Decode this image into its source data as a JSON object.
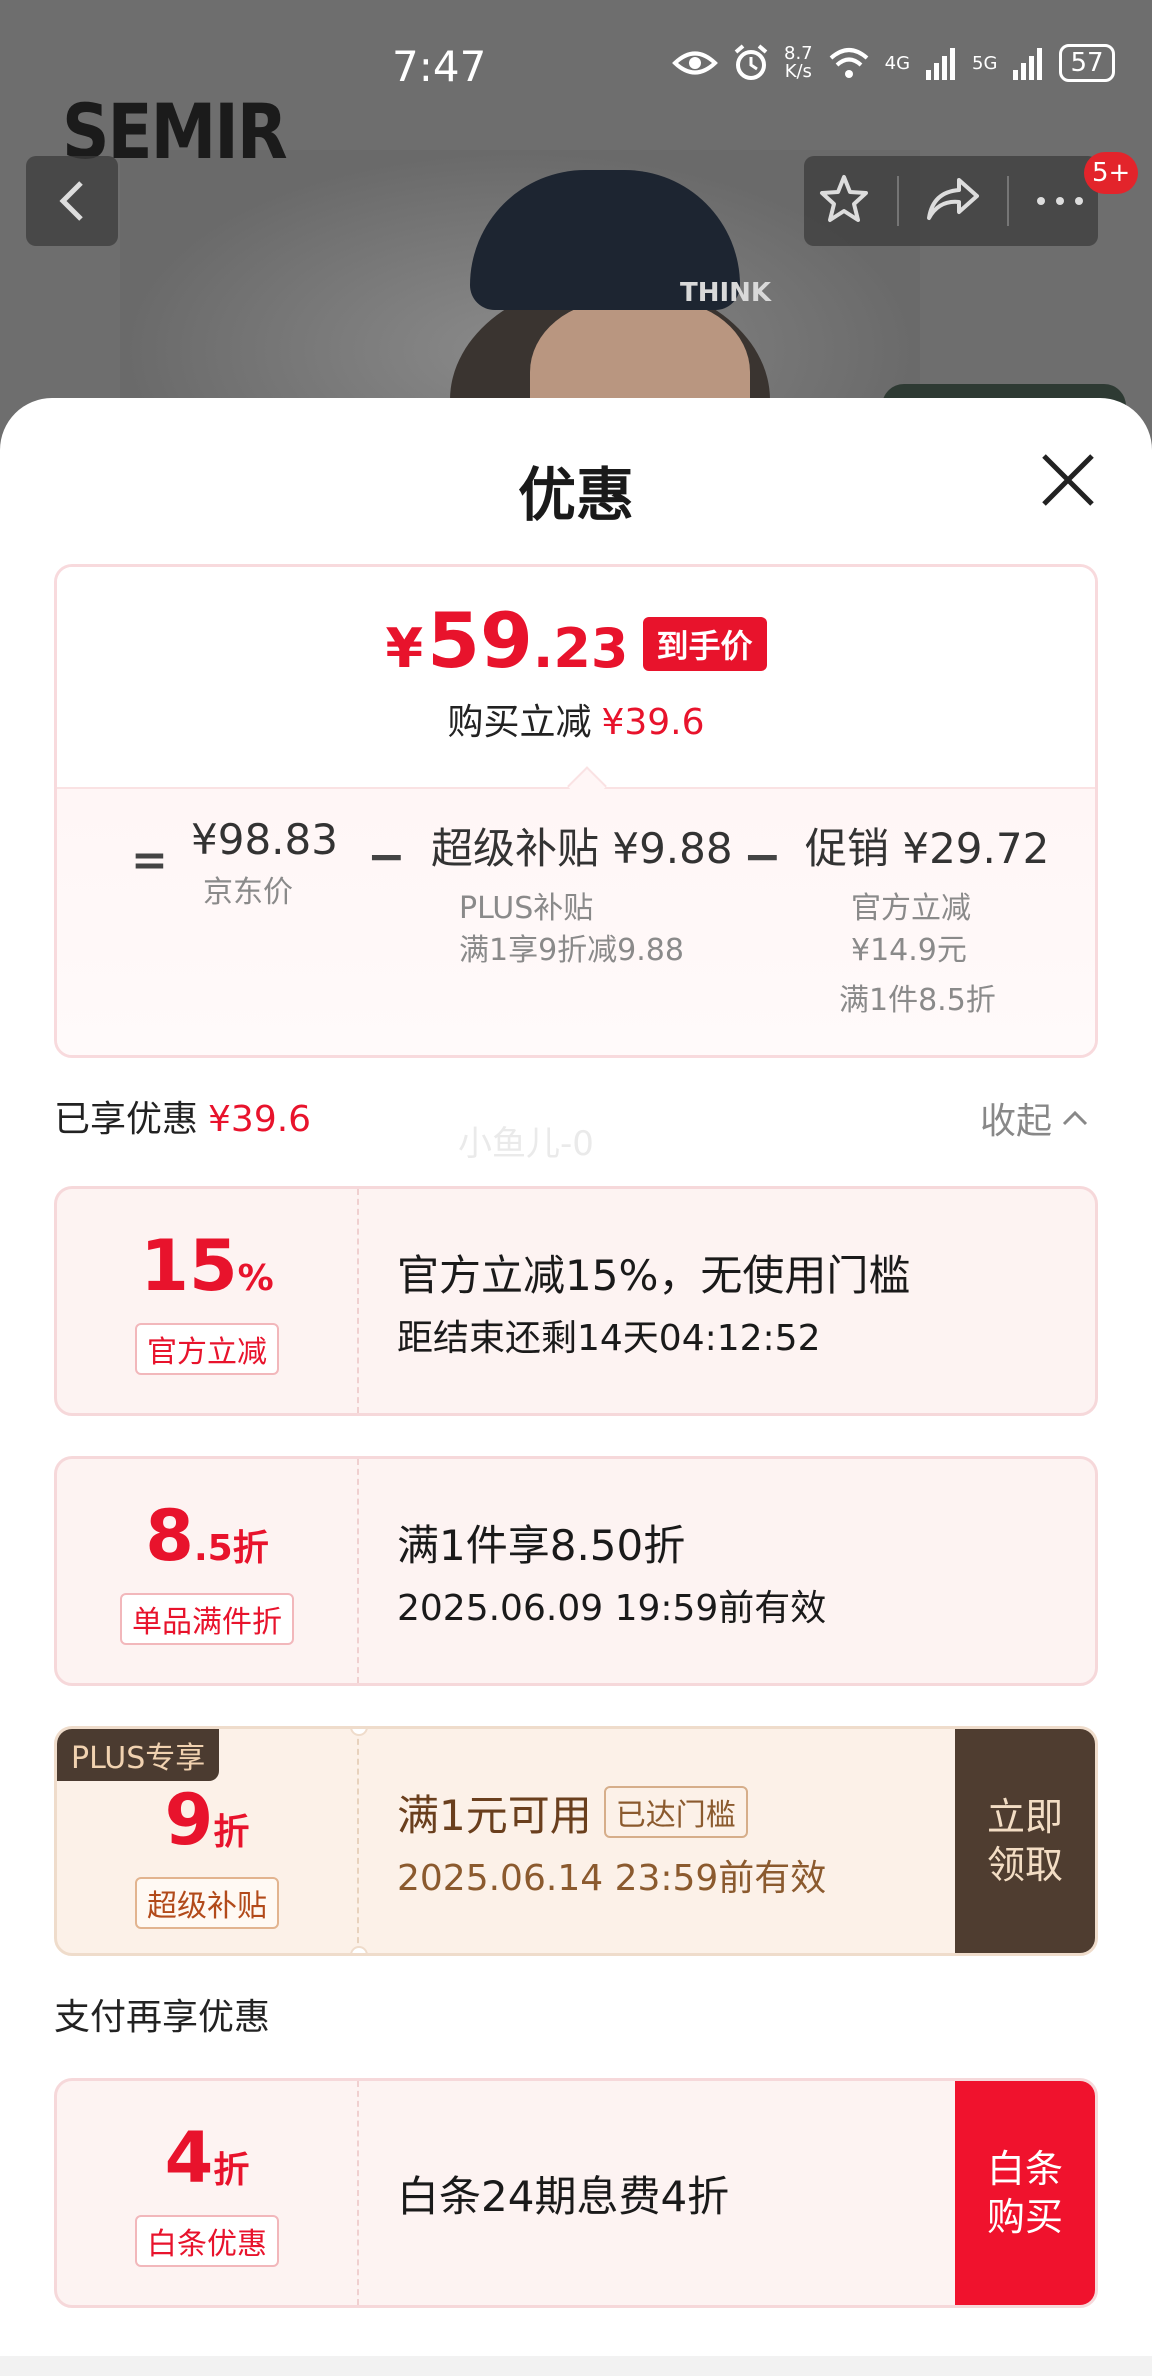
{
  "status_bar": {
    "time": "7:47",
    "net_speed_value": "8.7",
    "net_speed_unit": "K/s",
    "signal_1": "4G",
    "signal_2": "5G",
    "battery": "57"
  },
  "background": {
    "brand": "SEMIR",
    "cap_logo": "THINK",
    "notification_count": "5+"
  },
  "sheet": {
    "title": "优惠",
    "final_price": {
      "currency": "¥",
      "integer": "59",
      "decimal": ".23",
      "tag": "到手价"
    },
    "saving_label": "购买立减",
    "saving_amount": "¥39.6",
    "calc": {
      "equals": "=",
      "minus": "−",
      "jd_price": "¥98.83",
      "jd_label": "京东价",
      "subsidy_title": "超级补贴 ¥9.88",
      "subsidy_sub1": "PLUS补贴",
      "subsidy_sub2": "满1享9折减9.88",
      "promo_title": "促销 ¥29.72",
      "promo_sub1": "官方立减",
      "promo_sub2": "¥14.9元",
      "promo_sub3": "满1件8.5折"
    },
    "enjoyed_label": "已享优惠",
    "enjoyed_amount": "¥39.6",
    "collapse_label": "收起",
    "watermark": "小鱼儿-0",
    "coupons": [
      {
        "big": "15",
        "big_suffix": "%",
        "tag": "官方立减",
        "line1": "官方立减15%，无使用门槛",
        "line2": "距结束还剩14天04:12:52"
      },
      {
        "big": "8",
        "big_suffix": ".5折",
        "tag": "单品满件折",
        "line1": "满1件享8.50折",
        "line2": "2025.06.09 19:59前有效"
      },
      {
        "plus_tag": "PLUS专享",
        "big": "9",
        "big_suffix": "折",
        "tag": "超级补贴",
        "line1": "满1元可用",
        "reached_tag": "已达门槛",
        "line2": "2025.06.14 23:59前有效",
        "button_line1": "立即",
        "button_line2": "领取"
      }
    ],
    "pay_heading": "支付再享优惠",
    "pay_coupon": {
      "big": "4",
      "big_suffix": "折",
      "tag": "白条优惠",
      "line1": "白条24期息费4折",
      "button_line1": "白条",
      "button_line2": "购买"
    }
  },
  "colors": {
    "accent_red": "#e8132c",
    "plus_brown": "#4f3d30"
  }
}
